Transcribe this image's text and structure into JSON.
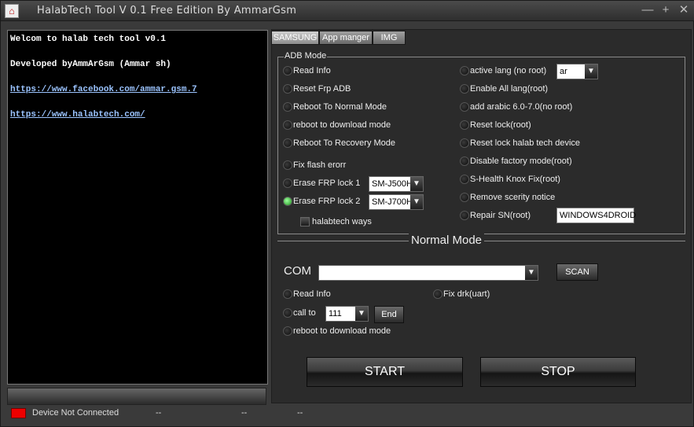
{
  "window": {
    "title": "HalabTech Tool V 0.1 Free Edition By AmmarGsm",
    "minimize": "—",
    "maximize": "+",
    "close": "✕",
    "icon": "⌂"
  },
  "console": {
    "lines": [
      "Welcom to halab tech tool v0.1",
      "Developed byAmmArGsm (Ammar sh)"
    ],
    "links": [
      "https://www.facebook.com/ammar.gsm.7",
      "https://www.halabtech.com/"
    ]
  },
  "tabs": [
    "SAMSUNG",
    "App manger",
    "IMG"
  ],
  "adb": {
    "legend": "ADB Mode",
    "left_options": [
      "Read Info",
      "Reset Frp ADB",
      "Reboot To Normal Mode",
      "reboot to download mode",
      "Reboot To Recovery Mode",
      "Fix flash erorr",
      "Erase FRP lock 1",
      "Erase FRP lock 2"
    ],
    "frp1_model": "SM-J500H",
    "frp2_model": "SM-J700H",
    "halabtech_ways": "halabtech ways",
    "right_options": [
      "active lang (no root)",
      "Enable All lang(root)",
      "add arabic 6.0-7.0(no root)",
      "Reset lock(root)",
      "Reset lock halab tech device",
      "Disable factory mode(root)",
      "S-Health Knox Fix(root)",
      "Remove scerity notice",
      "Repair SN(root)"
    ],
    "lang_value": "ar",
    "sn_value": "WINDOWS4DROID"
  },
  "normal": {
    "title": "Normal Mode",
    "com_label": "COM",
    "com_value": "",
    "scan": "SCAN",
    "read_info": "Read Info",
    "fix_drk": "Fix drk(uart)",
    "call_to": "call to",
    "call_value": "111",
    "end": "End",
    "reboot_download": "reboot to download mode"
  },
  "buttons": {
    "start": "START",
    "stop": "STOP"
  },
  "status": {
    "text": "Device Not Connected",
    "f1": "--",
    "f2": "--",
    "f3": "--",
    "led_color": "#e00000"
  },
  "colors": {
    "accent_link": "#9bc4ff",
    "selected_radio": "#1c8f1c"
  }
}
